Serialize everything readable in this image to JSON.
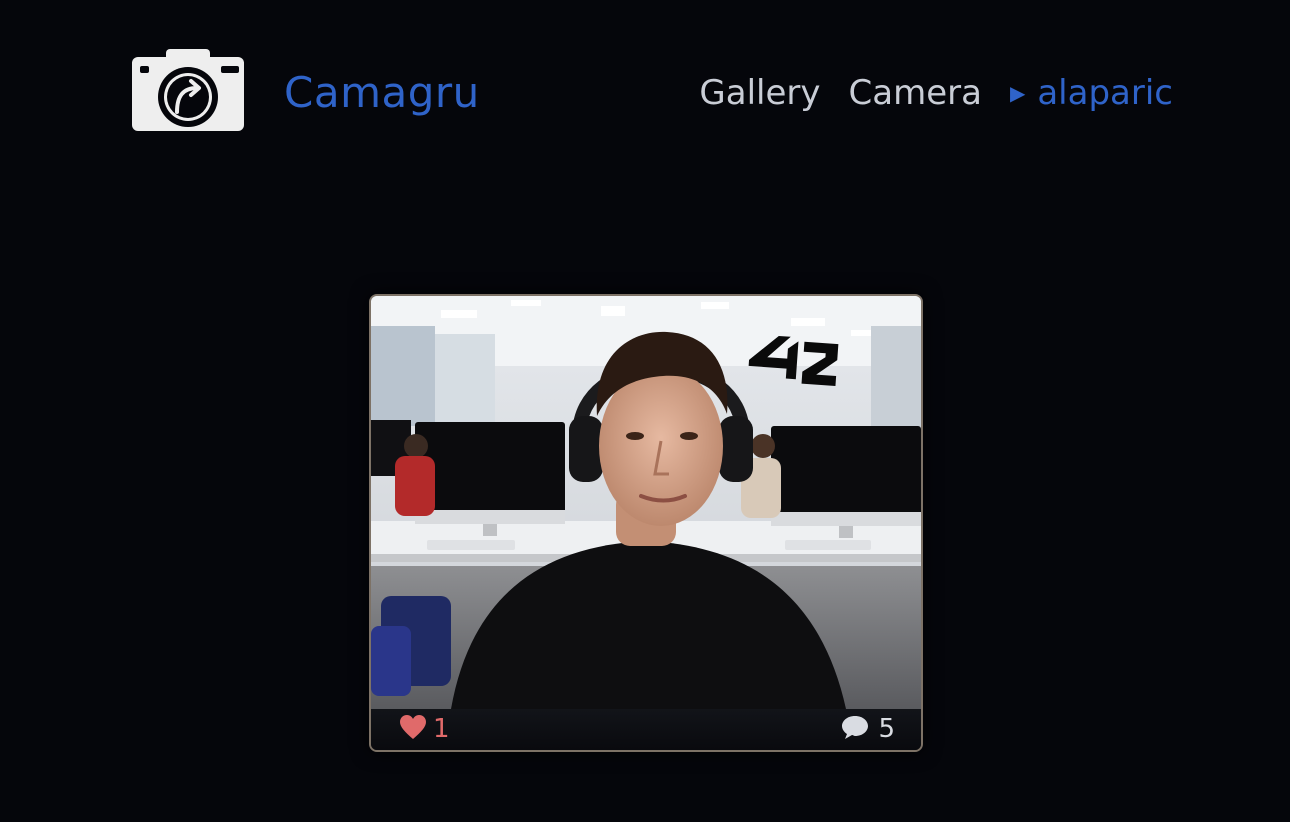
{
  "header": {
    "brand": "Camagru",
    "logo_icon": "camera-share-icon"
  },
  "nav": {
    "gallery": "Gallery",
    "camera": "Camera",
    "user_marker_icon": "triangle-right-icon",
    "user": "alaparic"
  },
  "post": {
    "photo_alt": "webcam photo with 42 sticker",
    "sticker_icon": "42-logo-sticker",
    "like_icon": "heart-icon",
    "likes": "1",
    "comment_icon": "speech-bubble-icon",
    "comments": "5"
  },
  "colors": {
    "background": "#05060b",
    "brand": "#2f63c9",
    "nav_text": "#c9cdd6",
    "like": "#e06a6a",
    "card_border": "#7d7266"
  }
}
